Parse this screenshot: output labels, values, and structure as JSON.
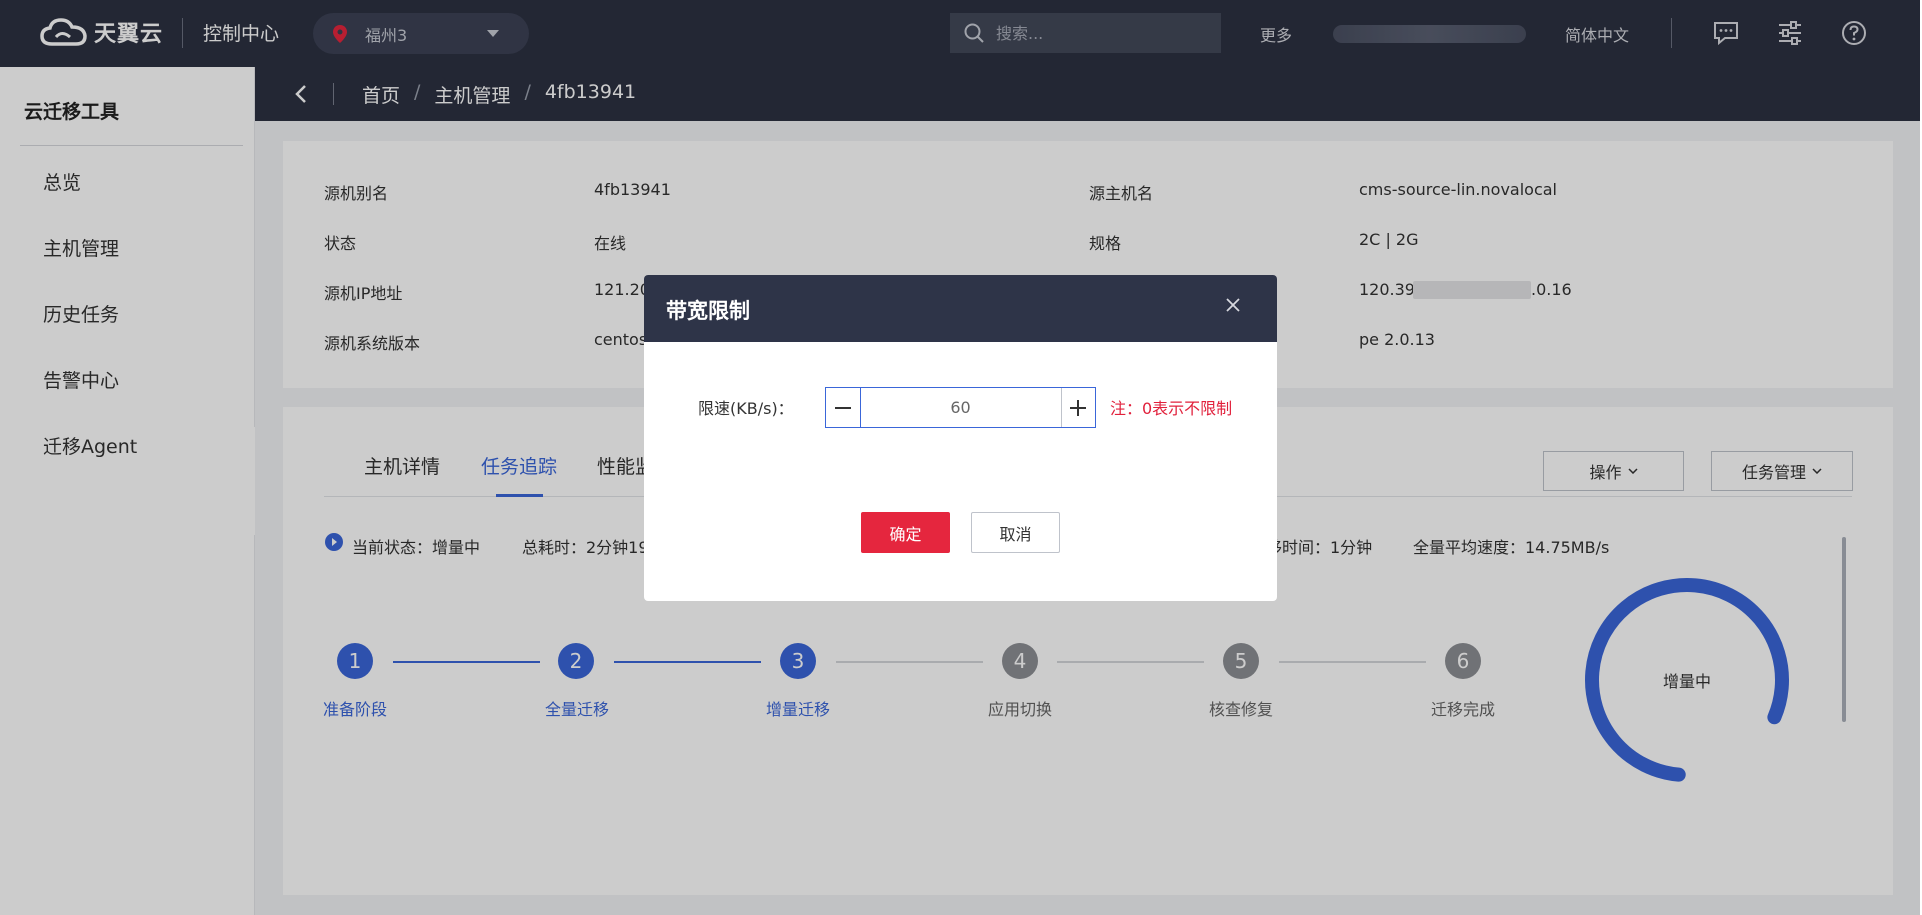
{
  "topbar": {
    "brand": "天翼云",
    "console": "控制中心",
    "region": "福州3",
    "search_placeholder": "搜索...",
    "more": "更多",
    "language": "简体中文"
  },
  "sidebar": {
    "title": "云迁移工具",
    "items": [
      {
        "label": "总览"
      },
      {
        "label": "主机管理"
      },
      {
        "label": "历史任务"
      },
      {
        "label": "告警中心"
      },
      {
        "label": "迁移Agent"
      }
    ]
  },
  "breadcrumb": {
    "items": [
      "首页",
      "主机管理",
      "4fb13941"
    ],
    "separator": "/"
  },
  "info": {
    "alias_label": "源机别名",
    "alias_value": "4fb13941",
    "host_label": "源主机名",
    "host_value": "cms-source-lin.novalocal",
    "status_label": "状态",
    "status_value": "在线",
    "spec_label": "规格",
    "spec_value": "2C | 2G",
    "ip_label": "源机IP地址",
    "ip_value_partial": "121.20",
    "target_ip_start": "120.39.",
    "target_ip_end": ".0.16",
    "os_label": "源机系统版本",
    "os_value_partial": "centos",
    "agent_value_partial": "pe 2.0.13"
  },
  "tabs": [
    {
      "label": "主机详情"
    },
    {
      "label": "任务追踪"
    },
    {
      "label": "性能监"
    }
  ],
  "actions": {
    "operate": "操作",
    "task_manage": "任务管理"
  },
  "status": {
    "current": "当前状态：增量中",
    "total_time": "总耗时：2分钟19",
    "migrate_time": "移时间：1分钟",
    "avg_speed": "全量平均速度：14.75MB/s"
  },
  "steps": [
    {
      "num": "1",
      "label": "准备阶段",
      "state": "done"
    },
    {
      "num": "2",
      "label": "全量迁移",
      "state": "done"
    },
    {
      "num": "3",
      "label": "增量迁移",
      "state": "done"
    },
    {
      "num": "4",
      "label": "应用切换",
      "state": "todo"
    },
    {
      "num": "5",
      "label": "核查修复",
      "state": "todo"
    },
    {
      "num": "6",
      "label": "迁移完成",
      "state": "todo"
    }
  ],
  "progress_ring": {
    "label": "增量中",
    "fraction": 0.8,
    "color": "#3a66d9"
  },
  "modal": {
    "title": "带宽限制",
    "limit_label": "限速(KB/s)：",
    "limit_value": "60",
    "note": "注：0表示不限制",
    "ok": "确定",
    "cancel": "取消"
  },
  "colors": {
    "topbar": "#2c3142",
    "primary": "#3a66d9",
    "danger": "#e5263e"
  }
}
